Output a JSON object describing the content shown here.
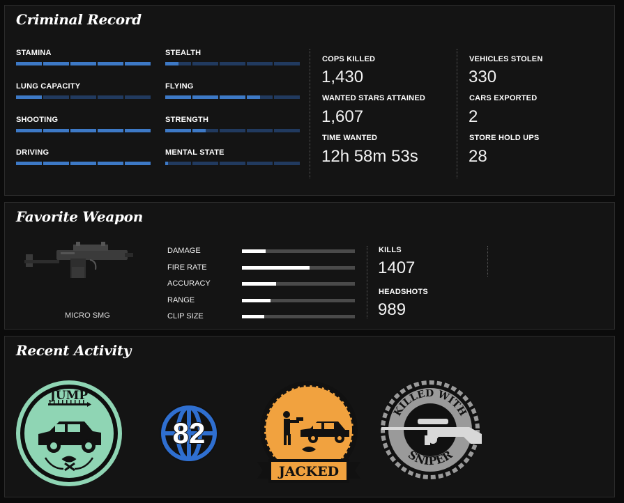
{
  "criminal_record": {
    "title": "Criminal Record",
    "skills": [
      {
        "label": "STAMINA",
        "level": 1.0
      },
      {
        "label": "STEALTH",
        "level": 0.1
      },
      {
        "label": "LUNG CAPACITY",
        "level": 0.2
      },
      {
        "label": "FLYING",
        "level": 0.7
      },
      {
        "label": "SHOOTING",
        "level": 1.0
      },
      {
        "label": "STRENGTH",
        "level": 0.3
      },
      {
        "label": "DRIVING",
        "level": 1.0
      },
      {
        "label": "MENTAL STATE",
        "level": 0.02
      }
    ],
    "stats_left": [
      {
        "label": "COPS KILLED",
        "value": "1,430"
      },
      {
        "label": "WANTED STARS ATTAINED",
        "value": "1,607"
      },
      {
        "label": "TIME WANTED",
        "value": "12h 58m 53s"
      }
    ],
    "stats_right": [
      {
        "label": "VEHICLES STOLEN",
        "value": "330"
      },
      {
        "label": "CARS EXPORTED",
        "value": "2"
      },
      {
        "label": "STORE HOLD UPS",
        "value": "28"
      }
    ]
  },
  "favorite_weapon": {
    "title": "Favorite Weapon",
    "weapon_name": "MICRO SMG",
    "stats": [
      {
        "label": "DAMAGE",
        "level": 0.21
      },
      {
        "label": "FIRE RATE",
        "level": 0.6
      },
      {
        "label": "ACCURACY",
        "level": 0.3
      },
      {
        "label": "RANGE",
        "level": 0.25
      },
      {
        "label": "CLIP SIZE",
        "level": 0.2
      }
    ],
    "kills_label": "KILLS",
    "kills_value": "1407",
    "headshots_label": "HEADSHOTS",
    "headshots_value": "989"
  },
  "recent_activity": {
    "title": "Recent Activity",
    "badges": [
      {
        "name": "jump-badge",
        "text": "JUMP",
        "color": "#8fd5b4"
      },
      {
        "name": "rank-badge",
        "text": "82",
        "color": "#2f6fd0"
      },
      {
        "name": "jacked-badge",
        "text": "JACKED",
        "color": "#f1a23f"
      },
      {
        "name": "sniper-badge",
        "text_top": "KILLED WITH",
        "text_bottom": "SNIPER",
        "color": "#9a9a9a"
      }
    ]
  },
  "colors": {
    "skill_fill": "#3d79c6",
    "skill_empty": "#213a5f",
    "weapon_fill": "#ffffff",
    "weapon_empty": "#4a4a4a"
  }
}
